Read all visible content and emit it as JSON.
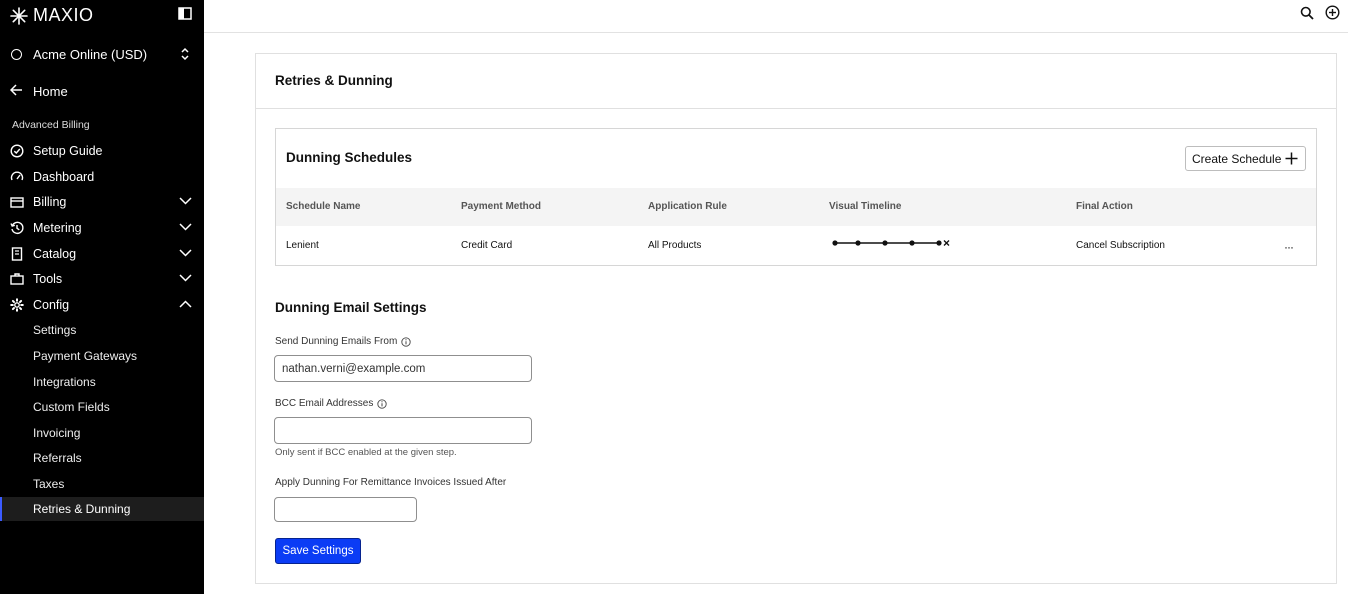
{
  "brand": {
    "name": "MAXIO"
  },
  "org": {
    "name": "Acme Online (USD)"
  },
  "nav": {
    "home": "Home",
    "section": "Advanced Billing",
    "items": [
      {
        "label": "Setup Guide",
        "icon": "check-circle-icon"
      },
      {
        "label": "Dashboard",
        "icon": "gauge-icon"
      },
      {
        "label": "Billing",
        "icon": "credit-card-icon",
        "chevron": "down"
      },
      {
        "label": "Metering",
        "icon": "history-icon",
        "chevron": "down"
      },
      {
        "label": "Catalog",
        "icon": "book-icon",
        "chevron": "down"
      },
      {
        "label": "Tools",
        "icon": "toolbox-icon",
        "chevron": "down"
      },
      {
        "label": "Config",
        "icon": "gear-icon",
        "chevron": "up"
      }
    ],
    "config_items": [
      "Settings",
      "Payment Gateways",
      "Integrations",
      "Custom Fields",
      "Invoicing",
      "Referrals",
      "Taxes",
      "Retries & Dunning"
    ],
    "active": "Retries & Dunning"
  },
  "page": {
    "title": "Retries & Dunning"
  },
  "schedules": {
    "title": "Dunning Schedules",
    "create_label": "Create Schedule",
    "columns": [
      "Schedule Name",
      "Payment Method",
      "Application Rule",
      "Visual Timeline",
      "Final Action"
    ],
    "rows": [
      {
        "name": "Lenient",
        "payment_method": "Credit Card",
        "rule": "All Products",
        "timeline_steps": 5,
        "final_action": "Cancel Subscription"
      }
    ]
  },
  "email_settings": {
    "title": "Dunning Email Settings",
    "from_label": "Send Dunning Emails From",
    "from_value": "nathan.verni@example.com",
    "bcc_label": "BCC Email Addresses",
    "bcc_value": "",
    "bcc_hint": "Only sent if BCC enabled at the given step.",
    "remittance_label": "Apply Dunning For Remittance Invoices Issued After",
    "remittance_value": "",
    "save_label": "Save Settings"
  }
}
